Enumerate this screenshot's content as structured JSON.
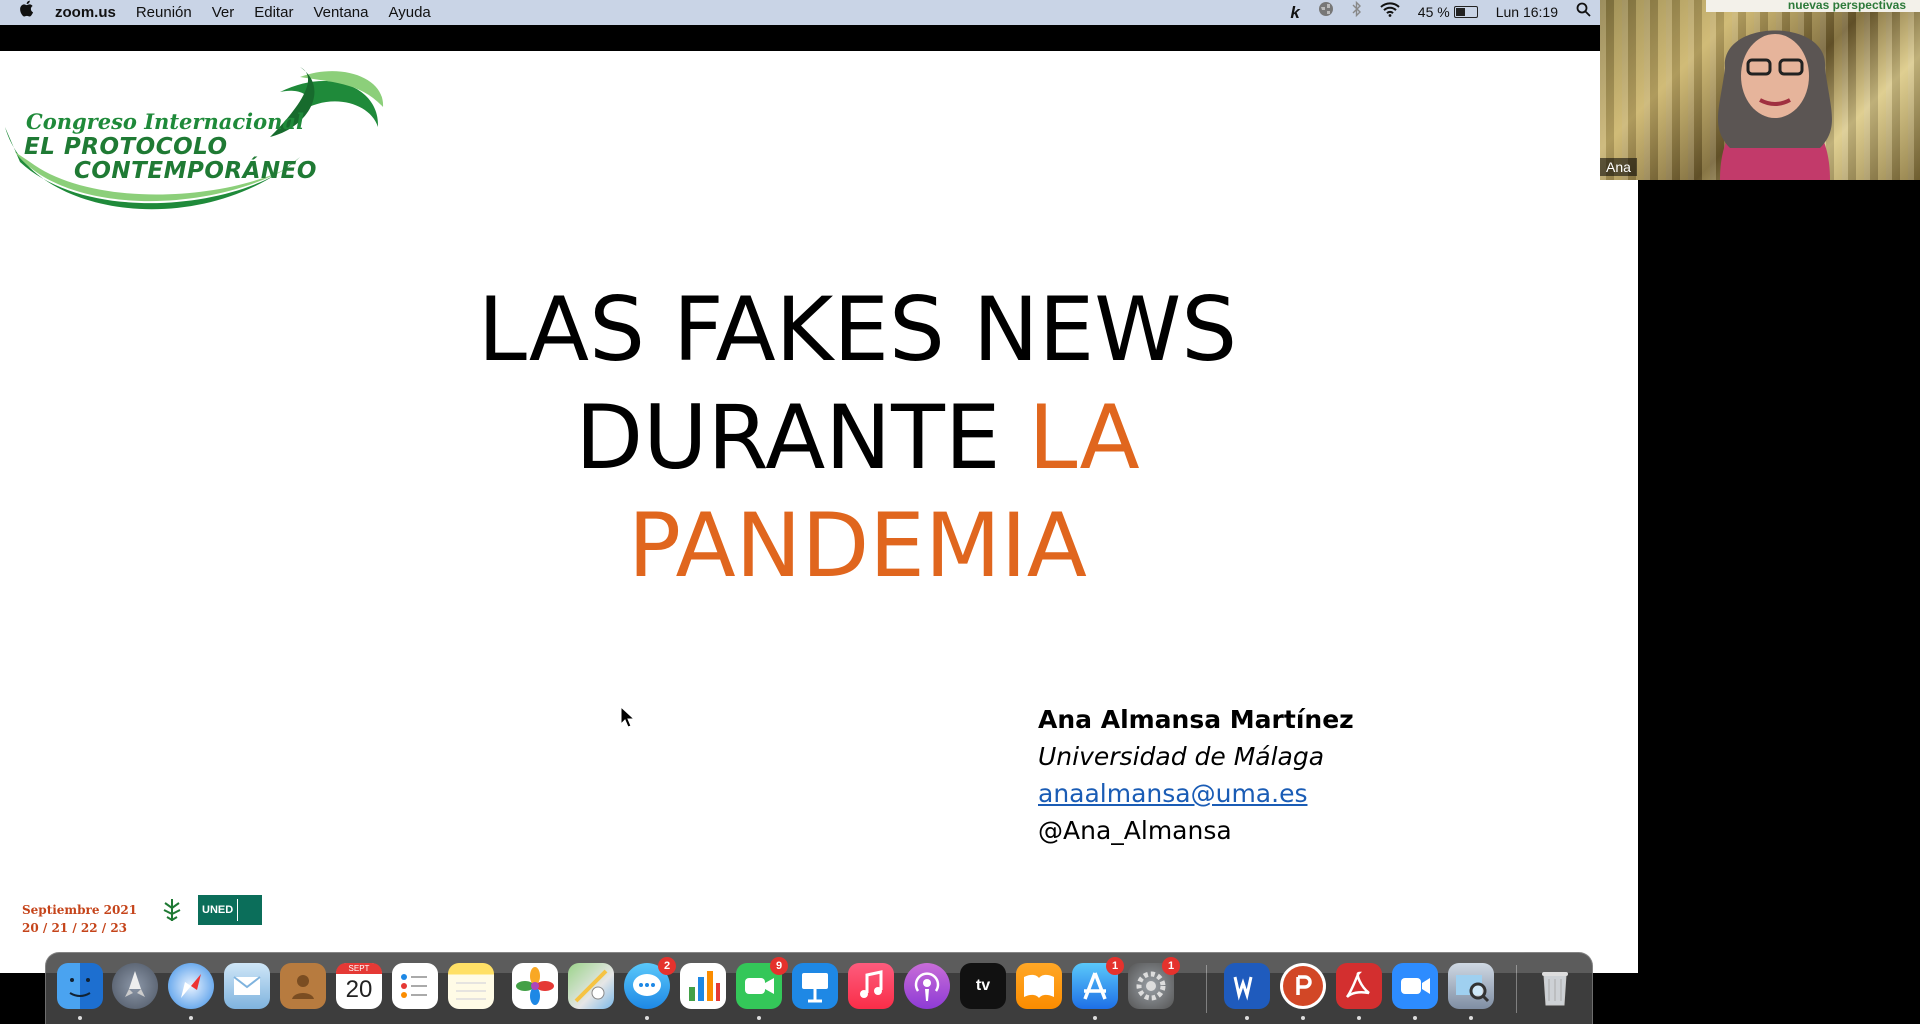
{
  "menubar": {
    "app_name": "zoom.us",
    "menus": [
      "Reunión",
      "Ver",
      "Editar",
      "Ventana",
      "Ayuda"
    ],
    "battery_percent": "45 %",
    "clock": "Lun 16:19"
  },
  "slide": {
    "logo": {
      "line1": "Congreso Internacional",
      "line2": "EL PROTOCOLO",
      "line3": "CONTEMPORÁNEO"
    },
    "title": {
      "line1": "LAS FAKES NEWS",
      "line2_black": "DURANTE ",
      "line2_orange": "LA",
      "line3": "PANDEMIA"
    },
    "author": {
      "name": "Ana Almansa Martínez",
      "university": "Universidad de Málaga",
      "email": "anaalmansa@uma.es",
      "handle": "@Ana_Almansa"
    },
    "footer": {
      "date_line1": "Septiembre 2021",
      "date_line2": "20 / 21 / 22 / 23",
      "uned_label": "UNED"
    }
  },
  "webcam": {
    "participant_name": "Ana",
    "banner_text": "nuevas perspectivas"
  },
  "dock": {
    "calendar_month": "SEPT",
    "calendar_day": "20",
    "messages_badge": "2",
    "facetime_badge": "9",
    "appstore_badge": "1",
    "settings_badge": "1",
    "appletv_label": "tv"
  },
  "colors": {
    "title_orange": "#e0661e",
    "logo_green": "#1f7a34",
    "link_blue": "#1a5cb5"
  }
}
